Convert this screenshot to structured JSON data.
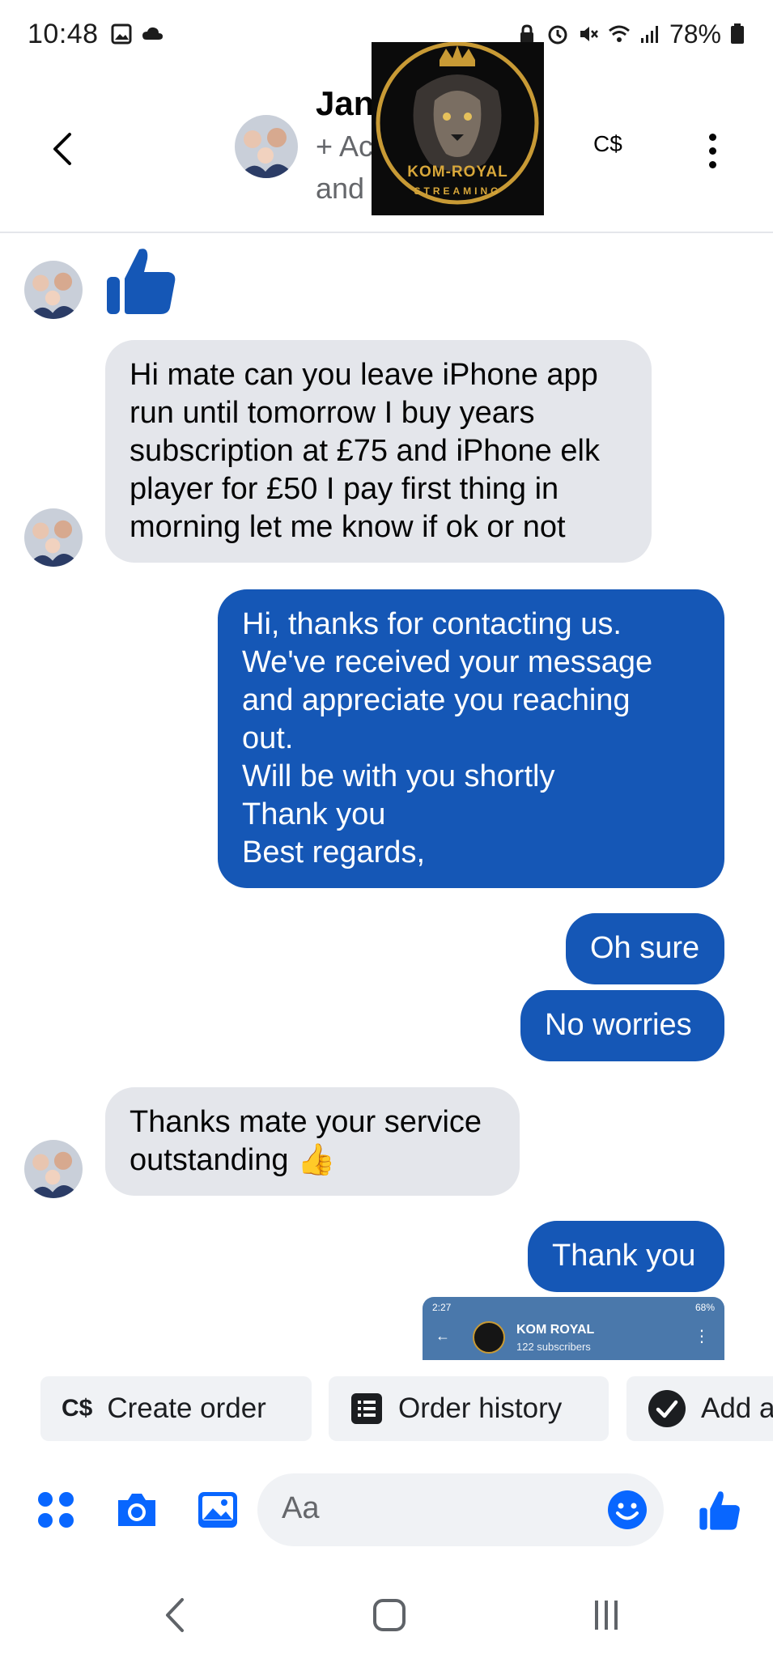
{
  "status_bar": {
    "time": "10:48",
    "battery": "78%"
  },
  "header": {
    "name": "Jan",
    "sub_line1": "+ Ac",
    "sub_line2": "and",
    "currency_label": "C$",
    "logo": {
      "title": "KOM-ROYAL",
      "subtitle": "STREAMING"
    }
  },
  "messages": [
    {
      "direction": "in",
      "lines": [
        "Hi mate can you leave iPhone app",
        "run until tomorrow I buy years",
        "subscription at £75 and iPhone elk",
        "player for £50 I pay first thing in",
        "morning  let me know if ok or not"
      ]
    },
    {
      "direction": "out",
      "lines": [
        "Hi, thanks for contacting us.",
        "We've received your message",
        "and appreciate you reaching",
        "out.",
        "Will be with you shortly",
        "Thank you",
        "Best regards,"
      ]
    },
    {
      "direction": "out",
      "lines": [
        "Oh sure"
      ]
    },
    {
      "direction": "out",
      "lines": [
        "No worries"
      ]
    },
    {
      "direction": "in",
      "lines": [
        "Thanks mate your service",
        "outstanding 👍"
      ]
    },
    {
      "direction": "out",
      "lines": [
        "Thank you"
      ]
    }
  ],
  "shared_preview": {
    "time": "2:27",
    "battery": "68%",
    "channel_name": "KOM ROYAL",
    "subscribers": "122 subscribers"
  },
  "quick_actions": [
    {
      "icon": "currency-icon",
      "icon_text": "C$",
      "label": "Create order"
    },
    {
      "icon": "list-icon",
      "label": "Order history"
    },
    {
      "icon": "check-circle-icon",
      "label": "Add a"
    }
  ],
  "composer": {
    "placeholder": "Aa"
  },
  "colors": {
    "outgoing_bubble": "#1557b6",
    "incoming_bubble": "#e4e6eb",
    "accent": "#0866ff"
  }
}
